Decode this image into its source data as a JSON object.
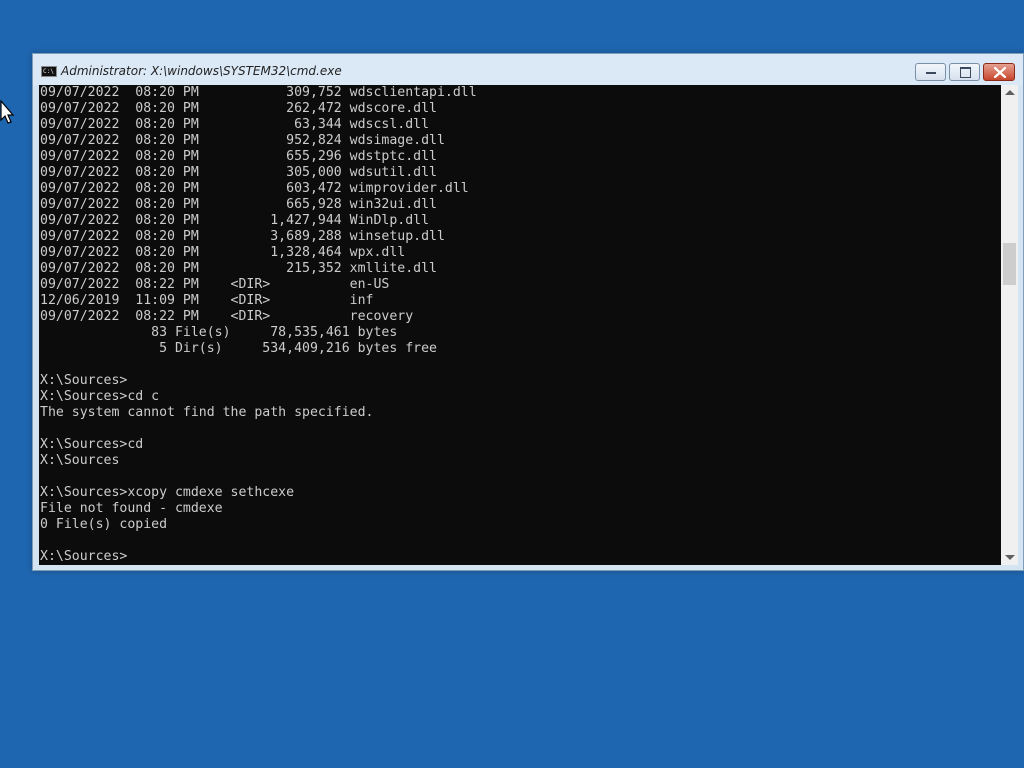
{
  "window": {
    "title": "Administrator: X:\\windows\\SYSTEM32\\cmd.exe",
    "title_icon_text": "C:\\",
    "accent_close": "#c8462c",
    "console_bg": "#0c0c0c",
    "console_fg": "#cccccc",
    "icons": [
      "cmd-icon",
      "minimize-icon",
      "restore-icon",
      "close-icon"
    ]
  },
  "scrollbar": {
    "position_fraction": 0.35
  },
  "console": {
    "lines": [
      "09/07/2022  08:20 PM           309,752 wdsclientapi.dll",
      "09/07/2022  08:20 PM           262,472 wdscore.dll",
      "09/07/2022  08:20 PM            63,344 wdscsl.dll",
      "09/07/2022  08:20 PM           952,824 wdsimage.dll",
      "09/07/2022  08:20 PM           655,296 wdstptc.dll",
      "09/07/2022  08:20 PM           305,000 wdsutil.dll",
      "09/07/2022  08:20 PM           603,472 wimprovider.dll",
      "09/07/2022  08:20 PM           665,928 win32ui.dll",
      "09/07/2022  08:20 PM         1,427,944 WinDlp.dll",
      "09/07/2022  08:20 PM         3,689,288 winsetup.dll",
      "09/07/2022  08:20 PM         1,328,464 wpx.dll",
      "09/07/2022  08:20 PM           215,352 xmllite.dll",
      "09/07/2022  08:22 PM    <DIR>          en-US",
      "12/06/2019  11:09 PM    <DIR>          inf",
      "09/07/2022  08:22 PM    <DIR>          recovery",
      "              83 File(s)     78,535,461 bytes",
      "               5 Dir(s)     534,409,216 bytes free",
      "",
      "X:\\Sources>",
      "X:\\Sources>cd c",
      "The system cannot find the path specified.",
      "",
      "X:\\Sources>cd",
      "X:\\Sources",
      "",
      "X:\\Sources>xcopy cmdexe sethcexe",
      "File not found - cmdexe",
      "0 File(s) copied",
      "",
      "X:\\Sources>"
    ]
  }
}
